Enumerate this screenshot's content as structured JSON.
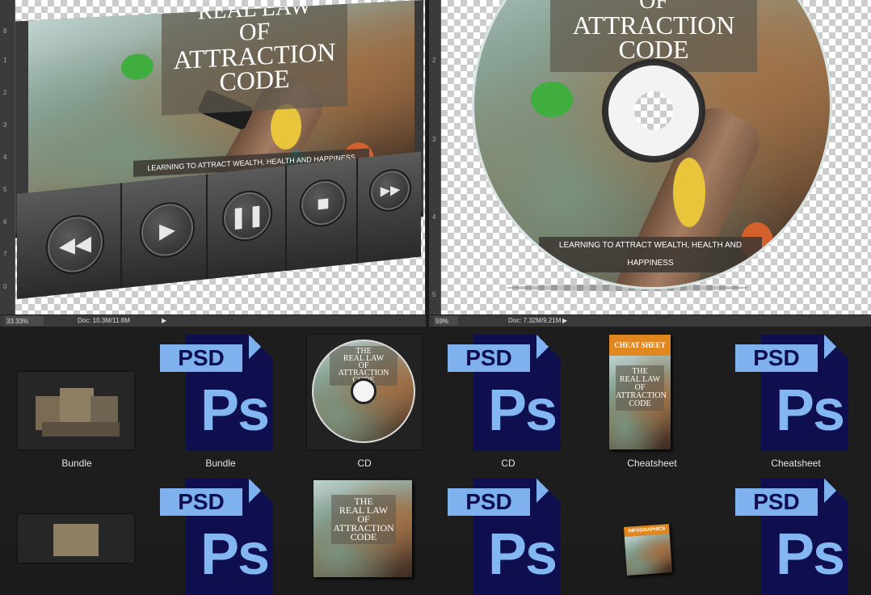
{
  "left_document": {
    "title_lines": [
      "REAL LAW",
      "OF",
      "ATTRACTION",
      "CODE"
    ],
    "tagline": "LEARNING TO ATTRACT WEALTH, HEALTH AND HAPPINESS",
    "ruler_numbers": [
      "8",
      "1",
      "2",
      "3",
      "4",
      "5",
      "6",
      "7",
      "0",
      "8"
    ],
    "zoom": "33.33%",
    "doc_info": "Doc: 10.3M/11.8M",
    "controls": [
      "rewind",
      "play",
      "pause",
      "stop",
      "fast-forward"
    ]
  },
  "right_document": {
    "title_lines": [
      "OF",
      "ATTRACTION",
      "CODE"
    ],
    "tagline": "LEARNING TO ATTRACT WEALTH, HEALTH AND HAPPINESS",
    "ruler_numbers": [
      "2",
      "3",
      "4",
      "5"
    ],
    "zoom": "59%",
    "doc_info": "Doc: 7.32M/9.21M"
  },
  "browser": {
    "row1": [
      {
        "caption": "Bundle",
        "kind": "thumbnail"
      },
      {
        "caption": "Bundle",
        "kind": "psd"
      },
      {
        "caption": "CD",
        "kind": "thumbnail"
      },
      {
        "caption": "CD",
        "kind": "psd"
      },
      {
        "caption": "Cheatsheet",
        "kind": "thumbnail"
      },
      {
        "caption": "Cheatsheet",
        "kind": "psd"
      }
    ],
    "psd_label": "PSD",
    "ps_label": "Ps",
    "cd_thumb_title": [
      "THE",
      "REAL LAW",
      "OF",
      "ATTRACTION",
      "CODE"
    ],
    "cheatsheet_header": "CHEAT SHEET",
    "cheatsheet_title": [
      "THE",
      "REAL LAW",
      "OF",
      "ATTRACTION",
      "CODE"
    ],
    "book_title": [
      "THE",
      "REAL LAW",
      "OF",
      "ATTRACTION",
      "CODE"
    ],
    "infographics_header": "INFOGRAPHICS"
  }
}
